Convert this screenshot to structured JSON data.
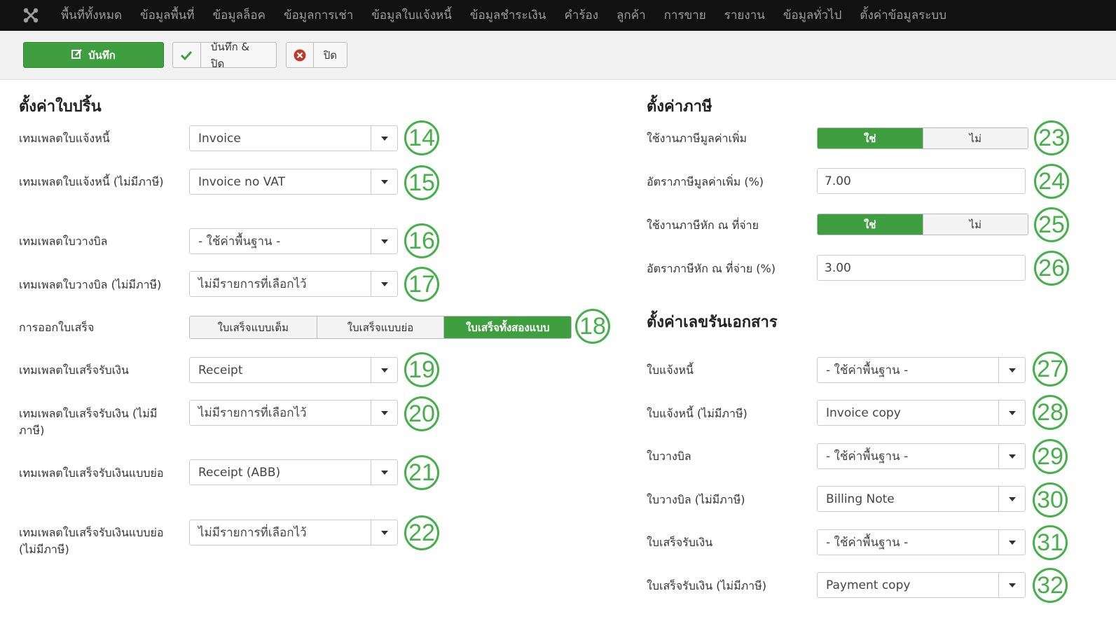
{
  "nav": {
    "items": [
      "พื้นที่ทั้งหมด",
      "ข้อมูลพื้นที่",
      "ข้อมูลล็อค",
      "ข้อมูลการเช่า",
      "ข้อมูลใบแจ้งหนี้",
      "ข้อมูลชำระเงิน",
      "คำร้อง",
      "ลูกค้า",
      "การขาย",
      "รายงาน",
      "ข้อมูลทั่วไป",
      "ตั้งค่าข้อมูลระบบ"
    ]
  },
  "toolbar": {
    "save_label": "บันทึก",
    "save_close_label": "บันทึก & ปิด",
    "close_label": "ปิด"
  },
  "print": {
    "title": "ตั้งค่าใบปริ้น",
    "fields": [
      {
        "label": "เทมเพลตใบแจ้งหนี้",
        "value": "Invoice",
        "badge": "14"
      },
      {
        "label": "เทมเพลตใบแจ้งหนี้ (ไม่มีภาษี)",
        "value": "Invoice no VAT",
        "badge": "15"
      },
      {
        "label": "เทมเพลตใบวางบิล",
        "value": "- ใช้ค่าพื้นฐาน -",
        "badge": "16"
      },
      {
        "label": "เทมเพลตใบวางบิล (ไม่มีภาษี)",
        "value": "ไม่มีรายการที่เลือกไว้",
        "badge": "17"
      },
      {
        "label": "การออกใบเสร็จ",
        "options": [
          "ใบเสร็จแบบเต็ม",
          "ใบเสร็จแบบย่อ",
          "ใบเสร็จทั้งสองแบบ"
        ],
        "selected": "ใบเสร็จทั้งสองแบบ",
        "badge": "18"
      },
      {
        "label": "เทมเพลตใบเสร็จรับเงิน",
        "value": "Receipt",
        "badge": "19"
      },
      {
        "label": "เทมเพลตใบเสร็จรับเงิน (ไม่มีภาษี)",
        "value": "ไม่มีรายการที่เลือกไว้",
        "badge": "20"
      },
      {
        "label": "เทมเพลตใบเสร็จรับเงินแบบย่อ",
        "value": "Receipt (ABB)",
        "badge": "21"
      },
      {
        "label": "เทมเพลตใบเสร็จรับเงินแบบย่อ (ไม่มีภาษี)",
        "value": "ไม่มีรายการที่เลือกไว้",
        "badge": "22"
      }
    ]
  },
  "tax": {
    "title": "ตั้งค่าภาษี",
    "fields": [
      {
        "label": "ใช้งานภาษีมูลค่าเพิ่ม",
        "options": [
          "ใช่",
          "ไม่"
        ],
        "selected": "ใช่",
        "badge": "23"
      },
      {
        "label": "อัตราภาษีมูลค่าเพิ่ม (%)",
        "value": "7.00",
        "badge": "24"
      },
      {
        "label": "ใช้งานภาษีหัก ณ ที่จ่าย",
        "options": [
          "ใช่",
          "ไม่"
        ],
        "selected": "ใช่",
        "badge": "25"
      },
      {
        "label": "อัตราภาษีหัก ณ ที่จ่าย (%)",
        "value": "3.00",
        "badge": "26"
      }
    ]
  },
  "docnum": {
    "title": "ตั้งค่าเลขรันเอกสาร",
    "fields": [
      {
        "label": "ใบแจ้งหนี้",
        "value": "- ใช้ค่าพื้นฐาน -",
        "badge": "27"
      },
      {
        "label": "ใบแจ้งหนี้ (ไม่มีภาษี)",
        "value": "Invoice copy",
        "badge": "28"
      },
      {
        "label": "ใบวางบิล",
        "value": "- ใช้ค่าพื้นฐาน -",
        "badge": "29"
      },
      {
        "label": "ใบวางบิล (ไม่มีภาษี)",
        "value": "Billing Note",
        "badge": "30"
      },
      {
        "label": "ใบเสร็จรับเงิน",
        "value": "- ใช้ค่าพื้นฐาน -",
        "badge": "31"
      },
      {
        "label": "ใบเสร็จรับเงิน (ไม่มีภาษี)",
        "value": "Payment copy",
        "badge": "32"
      }
    ]
  },
  "colors": {
    "accent": "#3f9e3f",
    "badge": "#46b04a",
    "nav_bg": "#111111"
  }
}
